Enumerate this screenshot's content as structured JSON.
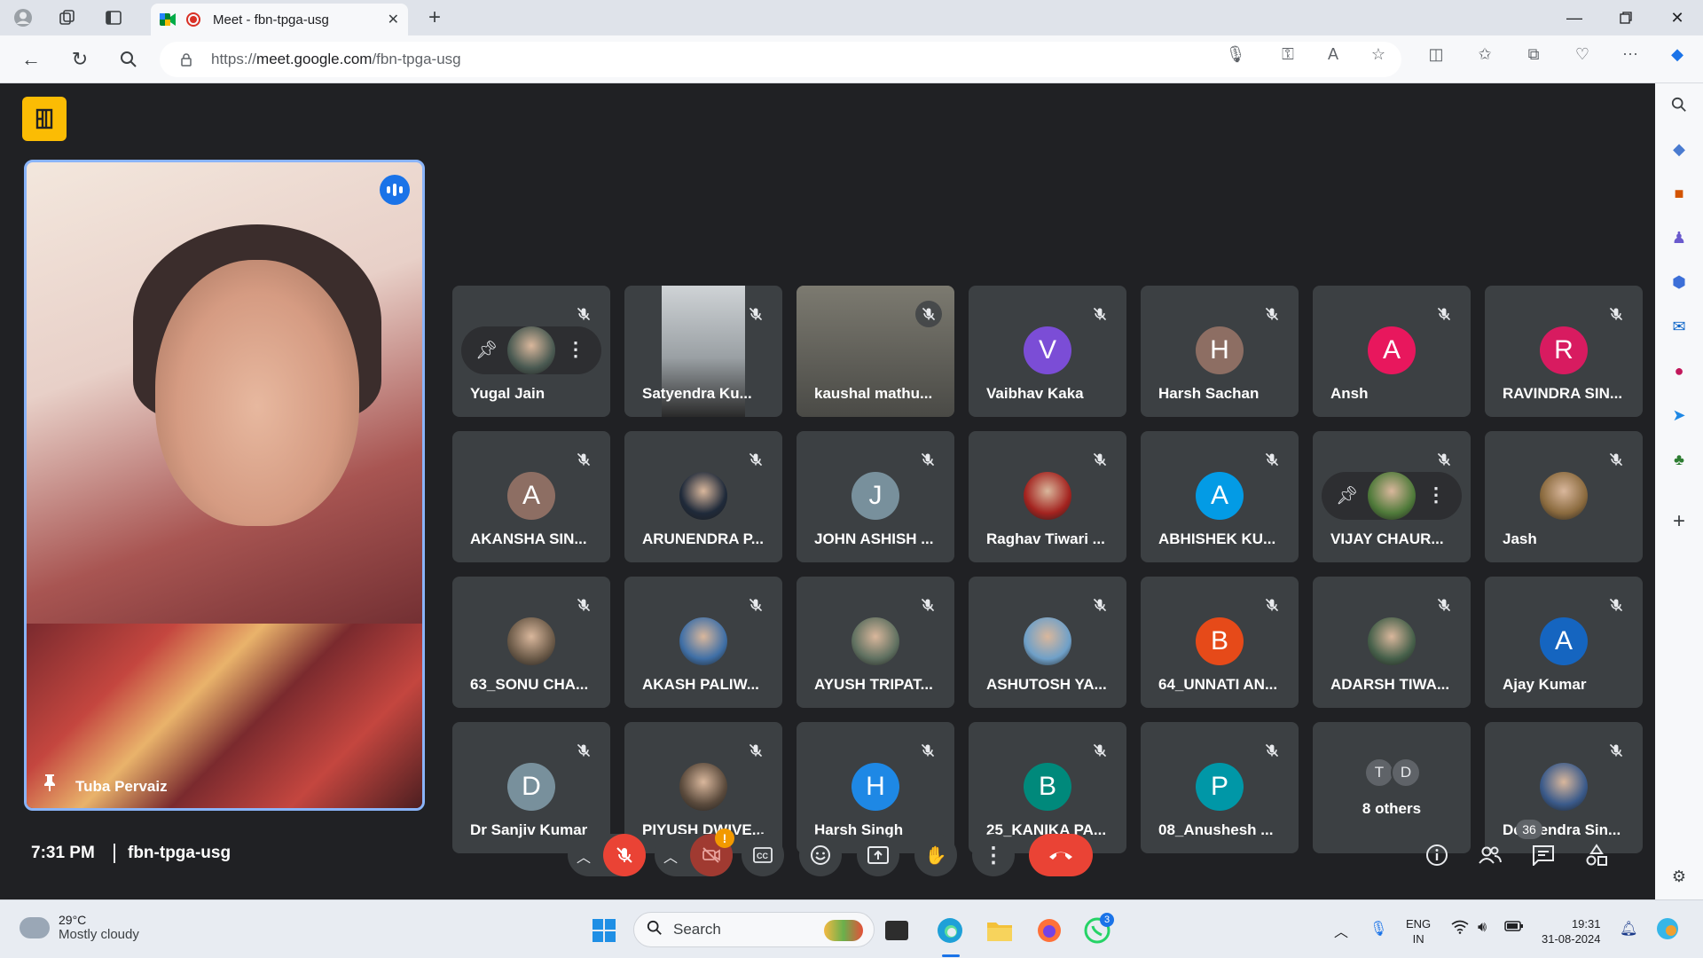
{
  "browser": {
    "tab_title": "Meet - fbn-tpga-usg",
    "url_prefix": "https://",
    "url_domain": "meet.google.com",
    "url_path": "/fbn-tpga-usg"
  },
  "meet": {
    "featured": {
      "name": "Tuba Pervaiz"
    },
    "tiles": [
      {
        "name": "Yugal Jain",
        "kind": "photo-hover",
        "color": "#4a5a52"
      },
      {
        "name": "Satyendra Ku...",
        "kind": "video",
        "color": "#8a8a86"
      },
      {
        "name": "kaushal mathu...",
        "kind": "video",
        "color": "#7c7a70"
      },
      {
        "name": "Vaibhav Kaka",
        "kind": "letter",
        "letter": "V",
        "color": "#7b4dd6"
      },
      {
        "name": "Harsh Sachan",
        "kind": "letter",
        "letter": "H",
        "color": "#8d6e63"
      },
      {
        "name": "Ansh",
        "kind": "letter",
        "letter": "A",
        "color": "#e8175d"
      },
      {
        "name": "RAVINDRA SIN...",
        "kind": "letter",
        "letter": "R",
        "color": "#d81b60"
      },
      {
        "name": "AKANSHA SIN...",
        "kind": "letter",
        "letter": "A",
        "color": "#8d6e63"
      },
      {
        "name": "ARUNENDRA P...",
        "kind": "photo",
        "color": "#1f2a3a"
      },
      {
        "name": "JOHN ASHISH ...",
        "kind": "letter",
        "letter": "J",
        "color": "#78909c"
      },
      {
        "name": "Raghav Tiwari ...",
        "kind": "photo",
        "color": "#a3231f"
      },
      {
        "name": "ABHISHEK KU...",
        "kind": "letter",
        "letter": "A",
        "color": "#039be5"
      },
      {
        "name": "VIJAY CHAUR...",
        "kind": "photo-hover",
        "color": "#4f7a3a"
      },
      {
        "name": "Jash",
        "kind": "photo",
        "color": "#8a6a3e"
      },
      {
        "name": "63_SONU CHA...",
        "kind": "photo",
        "color": "#6b5a48"
      },
      {
        "name": "AKASH PALIW...",
        "kind": "photo",
        "color": "#3f6fa6"
      },
      {
        "name": "AYUSH TRIPAT...",
        "kind": "photo",
        "color": "#5f7060"
      },
      {
        "name": "ASHUTOSH YA...",
        "kind": "photo",
        "color": "#6fa0c8"
      },
      {
        "name": "64_UNNATI AN...",
        "kind": "letter",
        "letter": "B",
        "color": "#e64a19"
      },
      {
        "name": "ADARSH TIWA...",
        "kind": "photo",
        "color": "#46604a"
      },
      {
        "name": "Ajay Kumar",
        "kind": "letter",
        "letter": "A",
        "color": "#1565c0"
      },
      {
        "name": "Dr Sanjiv Kumar",
        "kind": "letter",
        "letter": "D",
        "color": "#78909c"
      },
      {
        "name": "PIYUSH DWIVE...",
        "kind": "photo",
        "color": "#5a4a3c"
      },
      {
        "name": "Harsh Singh",
        "kind": "letter",
        "letter": "H",
        "color": "#1e88e5"
      },
      {
        "name": "25_KANIKA PA...",
        "kind": "letter",
        "letter": "B",
        "color": "#00897b"
      },
      {
        "name": "08_Anushesh ...",
        "kind": "letter",
        "letter": "P",
        "color": "#0097a7"
      },
      {
        "name": "8 others",
        "kind": "others",
        "letters": [
          "T",
          "D"
        ]
      },
      {
        "name": "Deependra Sin...",
        "kind": "photo",
        "color": "#3a5a8a"
      }
    ],
    "bottom": {
      "time": "7:31 PM",
      "meeting_code": "fbn-tpga-usg",
      "people_count": "36",
      "camera_alert": "!"
    }
  },
  "taskbar": {
    "weather_temp": "29°C",
    "weather_cond": "Mostly cloudy",
    "search_label": "Search",
    "whatsapp_badge": "3",
    "lang_1": "ENG",
    "lang_2": "IN",
    "clock_time": "19:31",
    "clock_date": "31-08-2024"
  },
  "colors": {
    "meet_bg": "#202124",
    "tile_bg": "#3c4043",
    "hangup_red": "#ea4335",
    "active_border": "#8ab4f8",
    "logo_yellow": "#fbbc04"
  }
}
